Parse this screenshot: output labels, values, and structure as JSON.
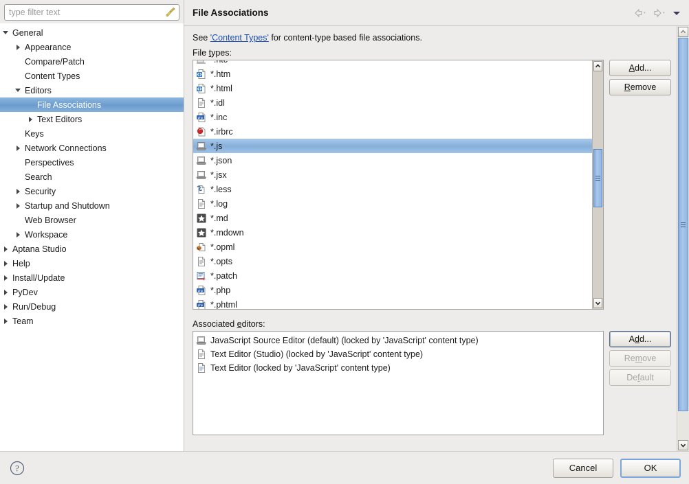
{
  "filter": {
    "placeholder": "type filter text",
    "value": "",
    "clear_icon": "broom-icon"
  },
  "sidebar": {
    "items": [
      {
        "label": "General",
        "depth": 0,
        "state": "open"
      },
      {
        "label": "Appearance",
        "depth": 1,
        "state": "closed"
      },
      {
        "label": "Compare/Patch",
        "depth": 1,
        "state": "leaf"
      },
      {
        "label": "Content Types",
        "depth": 1,
        "state": "leaf"
      },
      {
        "label": "Editors",
        "depth": 1,
        "state": "open"
      },
      {
        "label": "File Associations",
        "depth": 2,
        "state": "leaf",
        "selected": true
      },
      {
        "label": "Text Editors",
        "depth": 2,
        "state": "closed"
      },
      {
        "label": "Keys",
        "depth": 1,
        "state": "leaf"
      },
      {
        "label": "Network Connections",
        "depth": 1,
        "state": "closed"
      },
      {
        "label": "Perspectives",
        "depth": 1,
        "state": "leaf"
      },
      {
        "label": "Search",
        "depth": 1,
        "state": "leaf"
      },
      {
        "label": "Security",
        "depth": 1,
        "state": "closed"
      },
      {
        "label": "Startup and Shutdown",
        "depth": 1,
        "state": "closed"
      },
      {
        "label": "Web Browser",
        "depth": 1,
        "state": "leaf"
      },
      {
        "label": "Workspace",
        "depth": 1,
        "state": "closed"
      },
      {
        "label": "Aptana Studio",
        "depth": 0,
        "state": "closed"
      },
      {
        "label": "Help",
        "depth": 0,
        "state": "closed"
      },
      {
        "label": "Install/Update",
        "depth": 0,
        "state": "closed"
      },
      {
        "label": "PyDev",
        "depth": 0,
        "state": "closed"
      },
      {
        "label": "Run/Debug",
        "depth": 0,
        "state": "closed"
      },
      {
        "label": "Team",
        "depth": 0,
        "state": "closed"
      }
    ]
  },
  "header": {
    "title": "File Associations",
    "back_icon": "back-arrow-icon",
    "forward_icon": "forward-arrow-icon",
    "menu_icon": "view-menu-icon"
  },
  "main": {
    "see_prefix": "See ",
    "see_link": "'Content Types'",
    "see_suffix": " for content-type based file associations.",
    "file_types_label": "File types:",
    "file_types_label_mnemonic": "t",
    "associated_editors_label": "Associated editors:",
    "associated_editors_label_mnemonic": "e",
    "file_types": [
      {
        "ext": "*.htc",
        "icon": "generic-doc-icon",
        "clipped": true
      },
      {
        "ext": "*.htm",
        "icon": "html-icon"
      },
      {
        "ext": "*.html",
        "icon": "html-icon"
      },
      {
        "ext": "*.idl",
        "icon": "text-doc-icon"
      },
      {
        "ext": "*.inc",
        "icon": "php-icon"
      },
      {
        "ext": "*.irbrc",
        "icon": "ruby-icon"
      },
      {
        "ext": "*.js",
        "icon": "js-icon",
        "selected": true
      },
      {
        "ext": "*.json",
        "icon": "js-icon"
      },
      {
        "ext": "*.jsx",
        "icon": "js-icon"
      },
      {
        "ext": "*.less",
        "icon": "less-icon"
      },
      {
        "ext": "*.log",
        "icon": "text-doc-icon"
      },
      {
        "ext": "*.md",
        "icon": "markdown-star-icon"
      },
      {
        "ext": "*.mdown",
        "icon": "markdown-star-icon"
      },
      {
        "ext": "*.opml",
        "icon": "opml-icon"
      },
      {
        "ext": "*.opts",
        "icon": "text-doc-icon"
      },
      {
        "ext": "*.patch",
        "icon": "patch-icon"
      },
      {
        "ext": "*.php",
        "icon": "php-icon"
      },
      {
        "ext": "*.phtml",
        "icon": "php-icon",
        "clipped": true
      }
    ],
    "file_types_buttons": [
      {
        "label": "Add...",
        "mnemonic": "A",
        "state": "enabled",
        "name": "add-file-type-button"
      },
      {
        "label": "Remove",
        "mnemonic": "R",
        "state": "enabled",
        "name": "remove-file-type-button"
      }
    ],
    "associated_editors": [
      {
        "label": "JavaScript Source Editor (default) (locked by 'JavaScript' content type)",
        "icon": "js-icon"
      },
      {
        "label": "Text Editor (Studio) (locked by 'JavaScript' content type)",
        "icon": "text-doc-icon"
      },
      {
        "label": "Text Editor (locked by 'JavaScript' content type)",
        "icon": "text-doc-blue-icon"
      }
    ],
    "editor_buttons": [
      {
        "label": "Add...",
        "mnemonic": "d",
        "state": "focused",
        "name": "add-editor-button"
      },
      {
        "label": "Remove",
        "mnemonic": "m",
        "state": "disabled",
        "name": "remove-editor-button"
      },
      {
        "label": "Default",
        "mnemonic": "f",
        "state": "disabled",
        "name": "default-editor-button"
      }
    ]
  },
  "footer": {
    "help_icon": "help-question-icon",
    "cancel_label": "Cancel",
    "ok_label": "OK"
  },
  "colors": {
    "selection_blue": "#6f9fd0",
    "list_selection_blue": "#8bb4dd",
    "link_blue": "#1a4fb4",
    "dialog_bg": "#edecea",
    "focus_border": "#7aa7d9"
  }
}
